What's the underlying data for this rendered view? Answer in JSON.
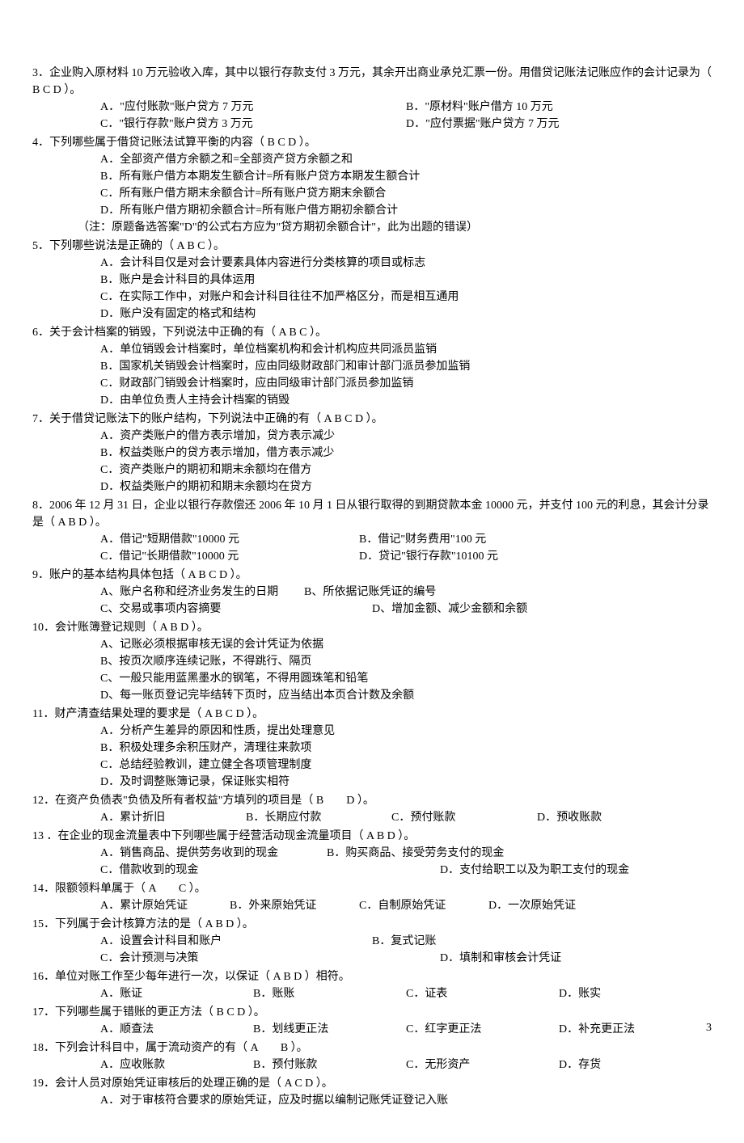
{
  "q3": {
    "stem": "3．企业购入原材料 10 万元验收入库，其中以银行存款支付 3 万元，其余开出商业承兑汇票一份。用借贷记账法记账应作的会计记录为（ B C D ）。",
    "a": "A．\"应付账款\"账户贷方 7 万元",
    "b": "B．\"原材料\"账户借方 10 万元",
    "c": "C．\"银行存款\"账户贷方 3 万元",
    "d": "D．\"应付票据\"账户贷方 7 万元"
  },
  "q4": {
    "stem": "4．下列哪些属于借贷记账法试算平衡的内容（ B C D ）。",
    "a": "A．全部资产借方余额之和=全部资产贷方余额之和",
    "b": "B．所有账户借方本期发生额合计=所有账户贷方本期发生额合计",
    "c": "C．所有账户借方期末余额合计=所有账户贷方期末余额合",
    "d": "D．所有账户借方期初余额合计=所有账户借方期初余额合计",
    "note": "（注：原题备选答案\"D\"的公式右方应为\"贷方期初余额合计\"，此为出题的错误）"
  },
  "q5": {
    "stem": "5．下列哪些说法是正确的（ A B C ）。",
    "a": "A．会计科目仅是对会计要素具体内容进行分类核算的项目或标志",
    "b": "B．账户是会计科目的具体运用",
    "c": "C．在实际工作中，对账户和会计科目往往不加严格区分，而是相互通用",
    "d": "D．账户没有固定的格式和结构"
  },
  "q6": {
    "stem": "6．关于会计档案的销毁，下列说法中正确的有（ A B C ）。",
    "a": "A．单位销毁会计档案时，单位档案机构和会计机构应共同派员监销",
    "b": "B．国家机关销毁会计档案时，应由同级财政部门和审计部门派员参加监销",
    "c": "C．财政部门销毁会计档案时，应由同级审计部门派员参加监销",
    "d": "D．由单位负责人主持会计档案的销毁"
  },
  "q7": {
    "stem": "7．关于借贷记账法下的账户结构，下列说法中正确的有（ A B C D ）。",
    "a": "A．资产类账户的借方表示增加，贷方表示减少",
    "b": "B．权益类账户的贷方表示增加，借方表示减少",
    "c": "C．资产类账户的期初和期末余额均在借方",
    "d": "D．权益类账户的期初和期末余额均在贷方"
  },
  "q8": {
    "stem": "8．2006 年 12 月 31 日，企业以银行存款偿还 2006 年 10 月 1 日从银行取得的到期贷款本金 10000 元，并支付 100 元的利息，其会计分录是（ A B D ）。",
    "a": "A．借记\"短期借款\"10000 元",
    "b": "B．借记\"财务费用\"100 元",
    "c": "C．借记\"长期借款\"10000 元",
    "d": "D．贷记\"银行存款\"10100 元"
  },
  "q9": {
    "stem": "9．账户的基本结构具体包括（ A B C D ）。",
    "a": "A、账户名称和经济业务发生的日期",
    "b": "B、所依据记账凭证的编号",
    "c": "C、交易或事项内容摘要",
    "d": "D、增加金额、减少金额和余额"
  },
  "q10": {
    "stem": "10．会计账簿登记规则（ A B D ）。",
    "a": "A、记账必须根据审核无误的会计凭证为依据",
    "b": "B、按页次顺序连续记账，不得跳行、隔页",
    "c": "C、一般只能用蓝黑墨水的钢笔，不得用圆珠笔和铅笔",
    "d": "D、每一账页登记完毕结转下页时，应当结出本页合计数及余额"
  },
  "q11": {
    "stem": "11．财产清查结果处理的要求是（ A B C D ）。",
    "a": "A．分析产生差异的原因和性质，提出处理意见",
    "b": "B．积极处理多余积压财产，清理往来款项",
    "c": "C．总结经验教训，建立健全各项管理制度",
    "d": "D．及时调整账簿记录，保证账实相符"
  },
  "q12": {
    "stem": "12．在资产负债表\"负债及所有者权益\"方填列的项目是（ B　　D ）。",
    "a": "A．累计折旧",
    "b": "B．长期应付款",
    "c": "C．预付账款",
    "d": "D．预收账款"
  },
  "q13": {
    "stem": "13 ．在企业的现金流量表中下列哪些属于经营活动现金流量项目（ A B D ）。",
    "a": "A．销售商品、提供劳务收到的现金",
    "b": "B．购买商品、接受劳务支付的现金",
    "c": "C．借款收到的现金",
    "d": "D．支付给职工以及为职工支付的现金"
  },
  "q14": {
    "stem": "14．限额领料单属于（ A　　C ）。",
    "a": "A．累计原始凭证",
    "b": "B．外来原始凭证",
    "c": "C．自制原始凭证",
    "d": "D．一次原始凭证"
  },
  "q15": {
    "stem": "15．下列属于会计核算方法的是（ A B D ）。",
    "a": "A．设置会计科目和账户",
    "b": "B．复式记账",
    "c": "C．会计预测与决策",
    "d": "D．填制和审核会计凭证"
  },
  "q16": {
    "stem": "16．单位对账工作至少每年进行一次，以保证（ A B D ）相符。",
    "a": "A．账证",
    "b": "B．账账",
    "c": "C．证表",
    "d": "D．账实"
  },
  "q17": {
    "stem": "17．下列哪些属于错账的更正方法（ B C D ）。",
    "a": "A．顺查法",
    "b": "B．划线更正法",
    "c": "C．红字更正法",
    "d": "D．补充更正法"
  },
  "q18": {
    "stem": "18．下列会计科目中，属于流动资产的有（ A　　B ）。",
    "a": "A．应收账款",
    "b": "B．预付账款",
    "c": "C．无形资产",
    "d": "D．存货"
  },
  "q19": {
    "stem": "19．会计人员对原始凭证审核后的处理正确的是（ A C D ）。",
    "a": "A．对于审核符合要求的原始凭证，应及时据以编制记账凭证登记入账"
  },
  "pageNum": "3"
}
